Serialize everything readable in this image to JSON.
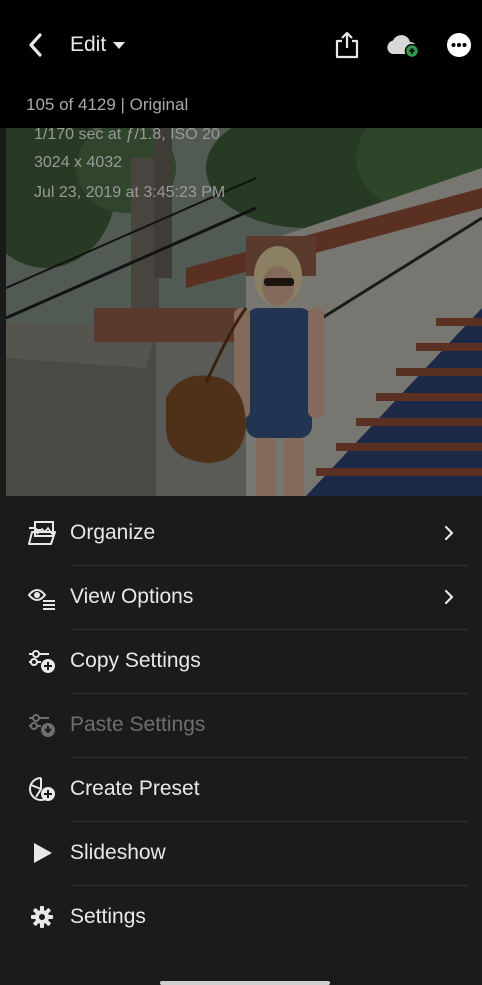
{
  "header": {
    "edit_label": "Edit",
    "counter": "105 of 4129 | Original"
  },
  "photo_info": {
    "exposure": "1/170 sec at ƒ/1.8, ISO 20",
    "dimensions": "3024 x 4032",
    "datetime": "Jul 23, 2019 at 3:45:23 PM"
  },
  "menu": {
    "items": [
      {
        "label": "Organize",
        "icon": "folder-photo-icon",
        "enabled": true,
        "has_submenu": true
      },
      {
        "label": "View Options",
        "icon": "view-options-icon",
        "enabled": true,
        "has_submenu": true
      },
      {
        "label": "Copy Settings",
        "icon": "copy-settings-icon",
        "enabled": true,
        "has_submenu": false
      },
      {
        "label": "Paste Settings",
        "icon": "paste-settings-icon",
        "enabled": false,
        "has_submenu": false
      },
      {
        "label": "Create Preset",
        "icon": "create-preset-icon",
        "enabled": true,
        "has_submenu": false
      },
      {
        "label": "Slideshow",
        "icon": "play-icon",
        "enabled": true,
        "has_submenu": false
      },
      {
        "label": "Settings",
        "icon": "gear-icon",
        "enabled": true,
        "has_submenu": false
      }
    ]
  },
  "colors": {
    "background": "#1b1b1b",
    "topbar": "#000000",
    "text": "#e8e8e8",
    "disabled_text": "#6e6e6e",
    "cloud_badge": "#2e9b4a"
  }
}
